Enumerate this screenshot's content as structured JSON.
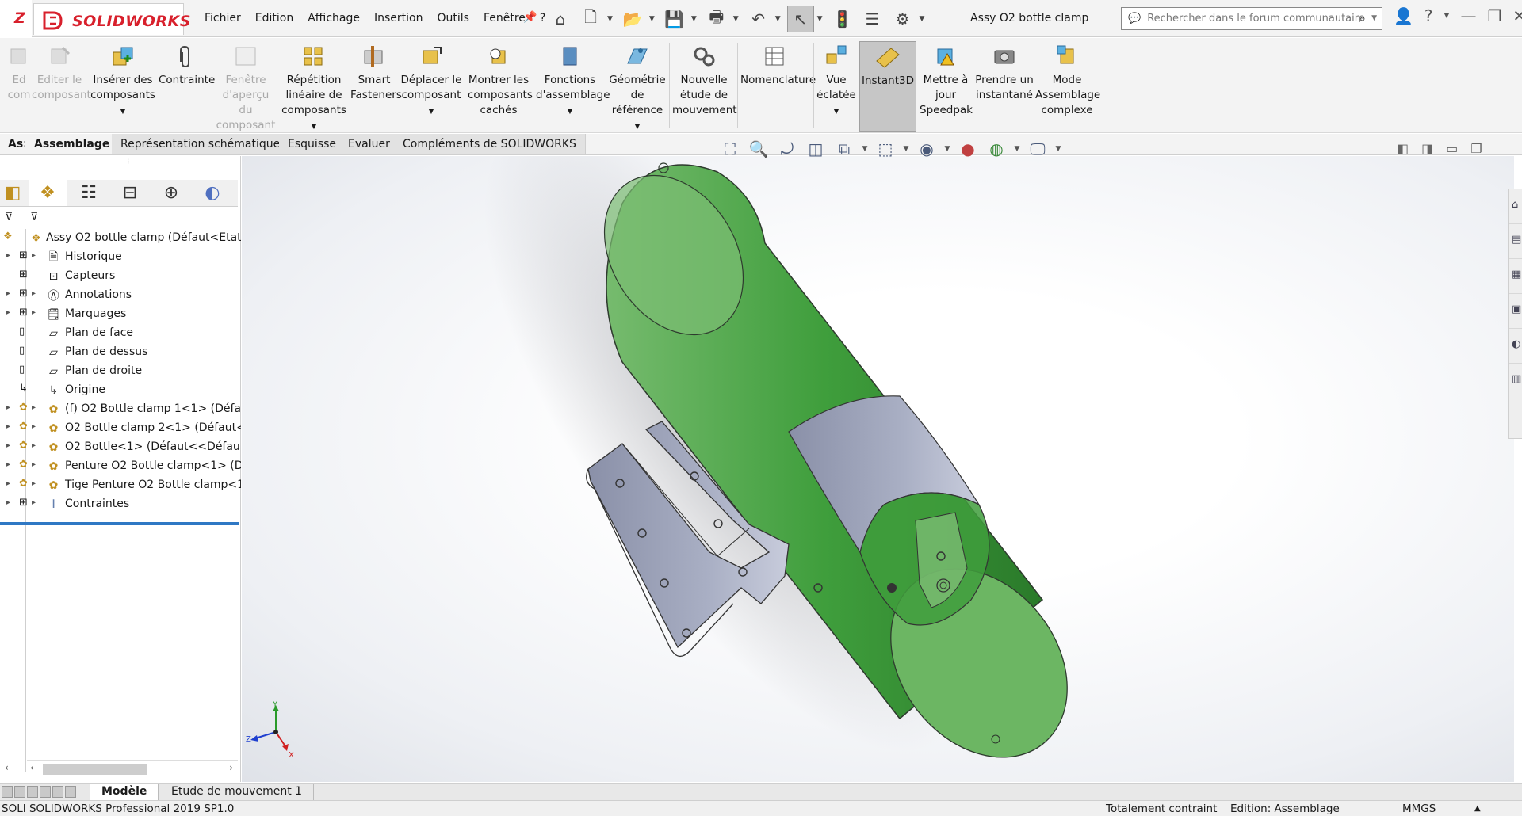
{
  "app": {
    "logo": "SOLIDWORKS",
    "title": "Assy O2 bottle clamp",
    "menu": [
      "Fichier",
      "Edition",
      "Affichage",
      "Insertion",
      "Outils",
      "Fenêtre",
      "?"
    ],
    "search_placeholder": "Rechercher dans le forum communautaire"
  },
  "ribbon": {
    "edit_component": "Editer le composant",
    "edit_component_cut": "Ed com",
    "insert_components": "Insérer des composants",
    "mate": "Contrainte",
    "preview_window": "Fenêtre d'aperçu du composant",
    "linear_pattern": "Répétition linéaire de composants",
    "smart_fasteners": "Smart Fasteners",
    "move_component": "Déplacer le composant",
    "show_hidden": "Montrer les composants cachés",
    "assembly_features": "Fonctions d'assemblage",
    "reference_geometry": "Géométrie de référence",
    "new_motion_study": "Nouvelle étude de mouvement",
    "bom": "Nomenclature",
    "exploded_view": "Vue éclatée",
    "instant3d": "Instant3D",
    "update_speedpak": "Mettre à jour Speedpak",
    "snapshot": "Prendre un instantané",
    "large_assembly": "Mode Assemblage complexe"
  },
  "tabs": {
    "cut_prefix": "As:",
    "items": [
      "Assemblage",
      "Représentation schématique",
      "Esquisse",
      "Evaluer",
      "Compléments de SOLIDWORKS"
    ]
  },
  "tree": {
    "root": "Assy O2 bottle clamp  (Défaut<Etat d",
    "history": "Historique",
    "sensors": "Capteurs",
    "annotations": "Annotations",
    "markups": "Marquages",
    "front_plane": "Plan de face",
    "top_plane": "Plan de dessus",
    "right_plane": "Plan de droite",
    "origin": "Origine",
    "c1": "(f) O2 Bottle clamp 1<1> (Défaut",
    "c2": "O2 Bottle clamp 2<1> (Défaut<<",
    "c3": "O2 Bottle<1> (Défaut<<Défaut>",
    "c4": "Penture O2 Bottle clamp<1> (Dé",
    "c5": "Tige Penture O2 Bottle clamp<1>",
    "mates": "Contraintes"
  },
  "triad": {
    "x": "X",
    "y": "Y",
    "z": "Z"
  },
  "bottom_tabs": [
    "Modèle",
    "Etude de mouvement 1"
  ],
  "status": {
    "product": "SOLI SOLIDWORKS Professional 2019 SP1.0",
    "constraint": "Totalement contraint",
    "mode": "Edition: Assemblage",
    "units": "MMGS"
  },
  "colors": {
    "brand_red": "#d8202c",
    "bottle_green": "#3f9e3c",
    "clamp_metal": "#a9afc4",
    "tree_highlight": "#2f78c4"
  }
}
